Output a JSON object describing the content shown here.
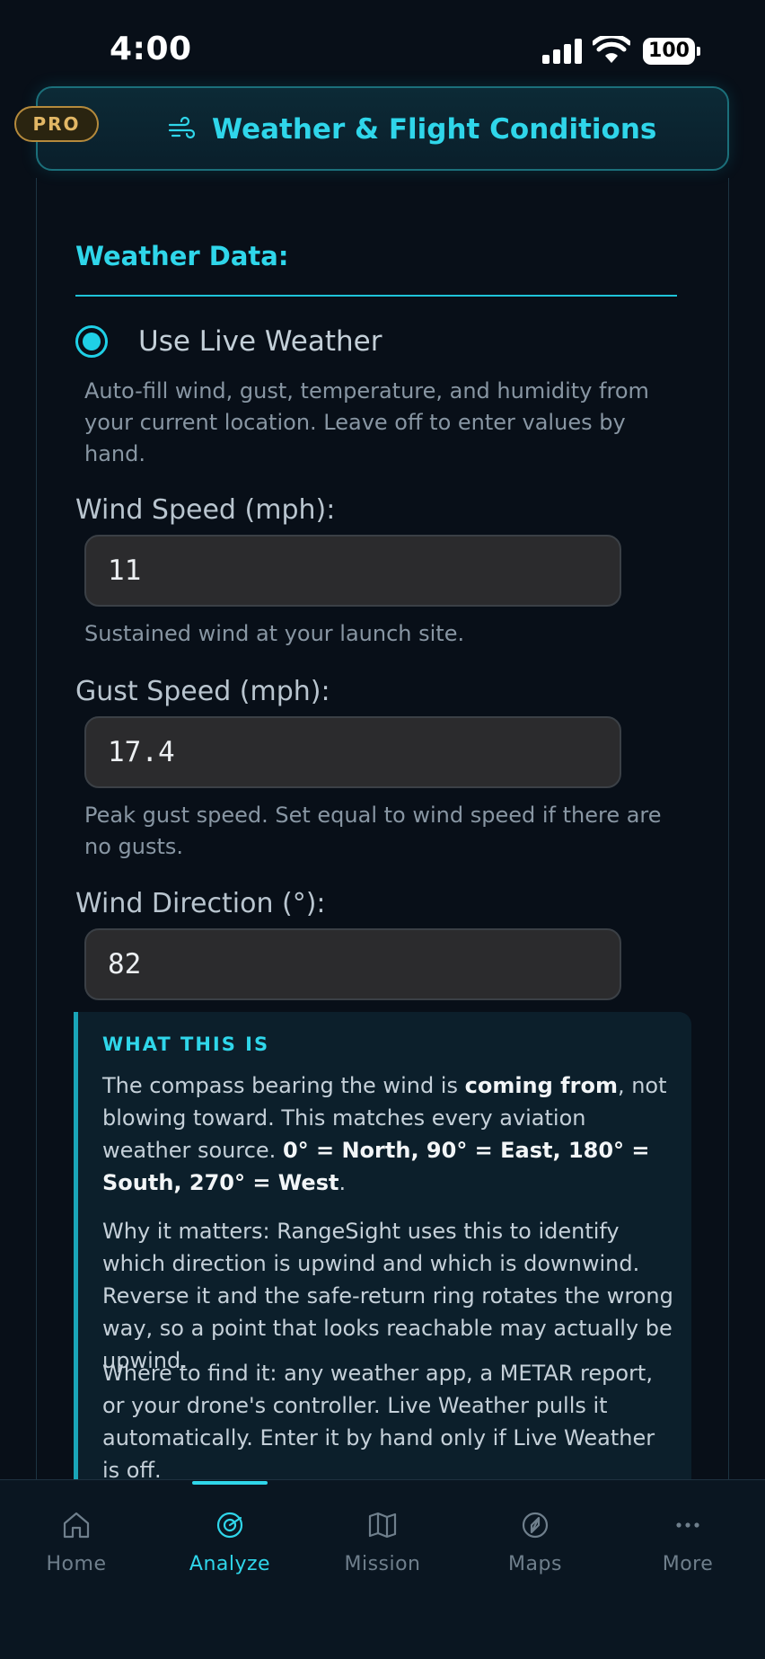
{
  "status_bar": {
    "time": "4:00",
    "battery": "100"
  },
  "header": {
    "badge": "PRO",
    "title": "Weather & Flight Conditions",
    "icon": "wind-icon"
  },
  "weather": {
    "heading": "Weather Data:",
    "live_weather": {
      "label": "Use Live Weather",
      "selected": true,
      "help_lines": [
        "Auto-fill wind, gust, temperature, and humidity from",
        "your current location. Leave off to enter values by",
        "hand."
      ]
    },
    "wind_speed": {
      "label": "Wind Speed (mph):",
      "value": "11",
      "help": "Sustained wind at your launch site."
    },
    "gust_speed": {
      "label": "Gust Speed (mph):",
      "value": "17.4",
      "help_lines": [
        "Peak gust speed. Set equal to wind speed if there are",
        "no gusts."
      ]
    },
    "wind_direction": {
      "label": "Wind Direction (°):",
      "value": "82"
    }
  },
  "info": {
    "heading": "WHAT THIS IS",
    "p1": {
      "a": "The compass bearing the wind is ",
      "b": "coming from",
      "c": ", not blowing toward. This matches every aviation weather source. ",
      "d": "0° = North, 90° = East, 180° = South, 270° = West",
      "e": "."
    },
    "p2": "Why it matters: RangeSight uses this to identify which direction is upwind and which is downwind. Reverse it and the safe-return ring rotates the wrong way, so a point that looks reachable may actually be upwind.",
    "p3": "Where to find it: any weather app, a METAR report, or your drone's controller. Live Weather pulls it automatically. Enter it by hand only if Live Weather is off."
  },
  "tabs": [
    {
      "label": "Home",
      "icon": "home-icon",
      "active": false
    },
    {
      "label": "Analyze",
      "icon": "analyze-icon",
      "active": true
    },
    {
      "label": "Mission",
      "icon": "map-icon",
      "active": false
    },
    {
      "label": "Maps",
      "icon": "compass-icon",
      "active": false
    },
    {
      "label": "More",
      "icon": "more-icon",
      "active": false
    }
  ],
  "colors": {
    "accent": "#2fd6ea",
    "background": "#080f18",
    "pro_gold": "#e2b765",
    "input_bg": "#2b2b2d"
  }
}
